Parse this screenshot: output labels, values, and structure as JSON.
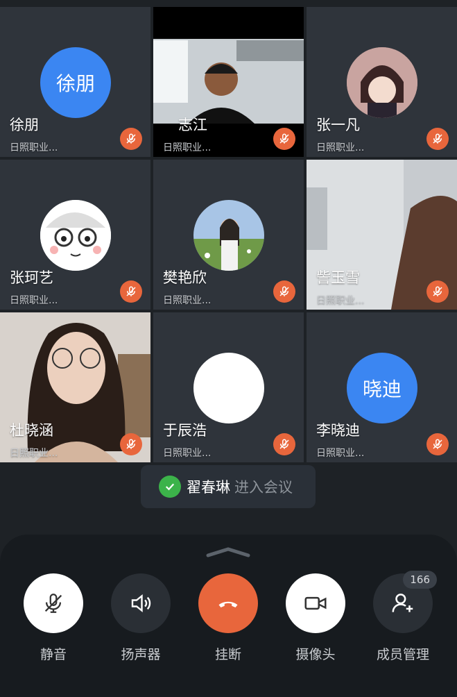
{
  "participants": [
    {
      "name": "徐朋",
      "org": "日照职业...",
      "avatar_text": "徐朋"
    },
    {
      "name": "志江",
      "org": "日照职业..."
    },
    {
      "name": "张一凡",
      "org": "日照职业..."
    },
    {
      "name": "张珂艺",
      "org": "日照职业..."
    },
    {
      "name": "樊艳欣",
      "org": "日照职业..."
    },
    {
      "name": "訾玉雪",
      "org": "日照职业..."
    },
    {
      "name": "杜晓涵",
      "org": "日照职业..."
    },
    {
      "name": "于辰浩",
      "org": "日照职业..."
    },
    {
      "name": "李晓迪",
      "org": "日照职业...",
      "avatar_text": "晓迪"
    }
  ],
  "toast": {
    "who": "翟春琳",
    "message": "进入会议"
  },
  "controls": {
    "mute": "静音",
    "speaker": "扬声器",
    "hangup": "挂断",
    "camera": "摄像头",
    "members": "成员管理",
    "member_count": "166"
  },
  "colors": {
    "accent_blue": "#3b86f2",
    "mic_off": "#e8663c",
    "hangup": "#e8663c",
    "success": "#3cb34a"
  }
}
